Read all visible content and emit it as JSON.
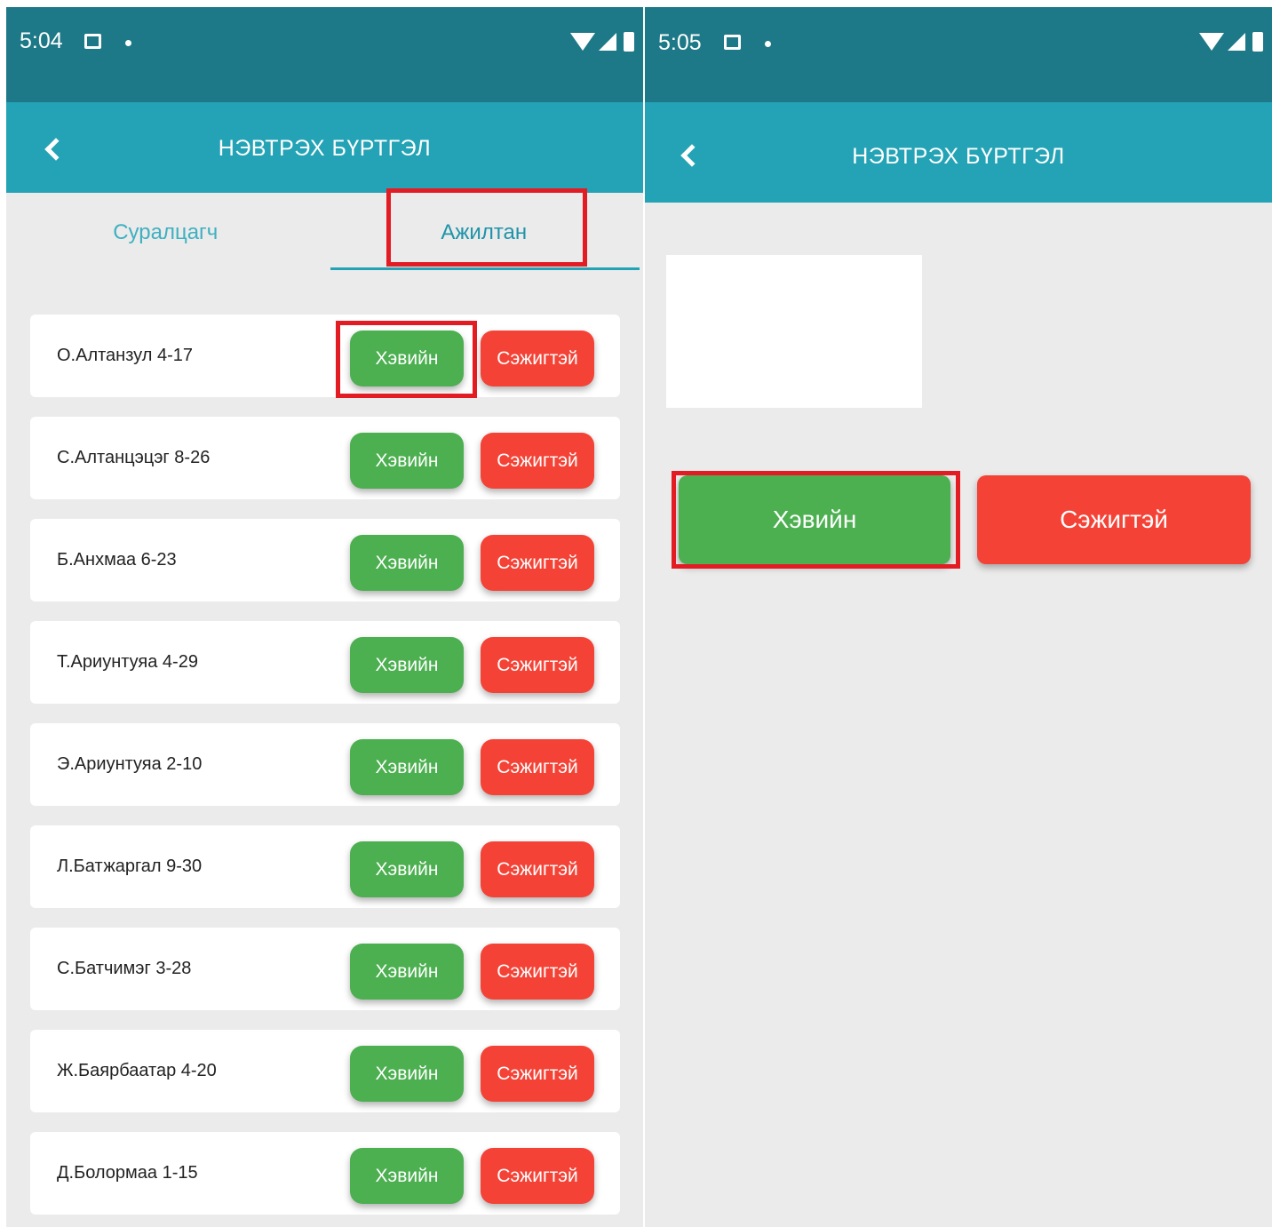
{
  "left_screen": {
    "status_bar": {
      "time": "5:04"
    },
    "app_bar": {
      "title": "НЭВТРЭХ БҮРТГЭЛ"
    },
    "tabs": [
      {
        "label": "Суралцагч",
        "selected": false
      },
      {
        "label": "Ажилтан",
        "selected": true
      }
    ],
    "rows": [
      {
        "name": "О.Алтанзул  4-17",
        "left_button": "Хэвийн",
        "right_button": "Сэжигтэй"
      },
      {
        "name": "С.Алтанцэцэг  8-26",
        "left_button": "Хэвийн",
        "right_button": "Сэжигтэй"
      },
      {
        "name": "Б.Анхмаа  6-23",
        "left_button": "Хэвийн",
        "right_button": "Сэжигтэй"
      },
      {
        "name": "Т.Ариунтуяа  4-29",
        "left_button": "Хэвийн",
        "right_button": "Сэжигтэй"
      },
      {
        "name": "Э.Ариунтуяа  2-10",
        "left_button": "Хэвийн",
        "right_button": "Сэжигтэй"
      },
      {
        "name": "Л.Батжаргал  9-30",
        "left_button": "Хэвийн",
        "right_button": "Сэжигтэй"
      },
      {
        "name": "С.Батчимэг  3-28",
        "left_button": "Хэвийн",
        "right_button": "Сэжигтэй"
      },
      {
        "name": "Ж.Баярбаатар  4-20",
        "left_button": "Хэвийн",
        "right_button": "Сэжигтэй"
      },
      {
        "name": "Д.Болормаа  1-15",
        "left_button": "Хэвийн",
        "right_button": "Сэжигтэй"
      }
    ]
  },
  "right_screen": {
    "status_bar": {
      "time": "5:05"
    },
    "app_bar": {
      "title": "НЭВТРЭХ БҮРТГЭЛ"
    },
    "normal_button": "Хэвийн",
    "suspicious_button": "Сэжигтэй"
  },
  "colors": {
    "status_bar": "#1d7987",
    "app_bar": "#23a3b5",
    "normal": "#4caf50",
    "suspicious": "#f44336",
    "highlight": "#e31c24",
    "background": "#ebebeb"
  },
  "icons": {
    "back": "chevron-left-icon",
    "notification": "notification-icon",
    "wifi": "wifi-icon",
    "signal": "signal-icon",
    "battery": "battery-icon"
  }
}
